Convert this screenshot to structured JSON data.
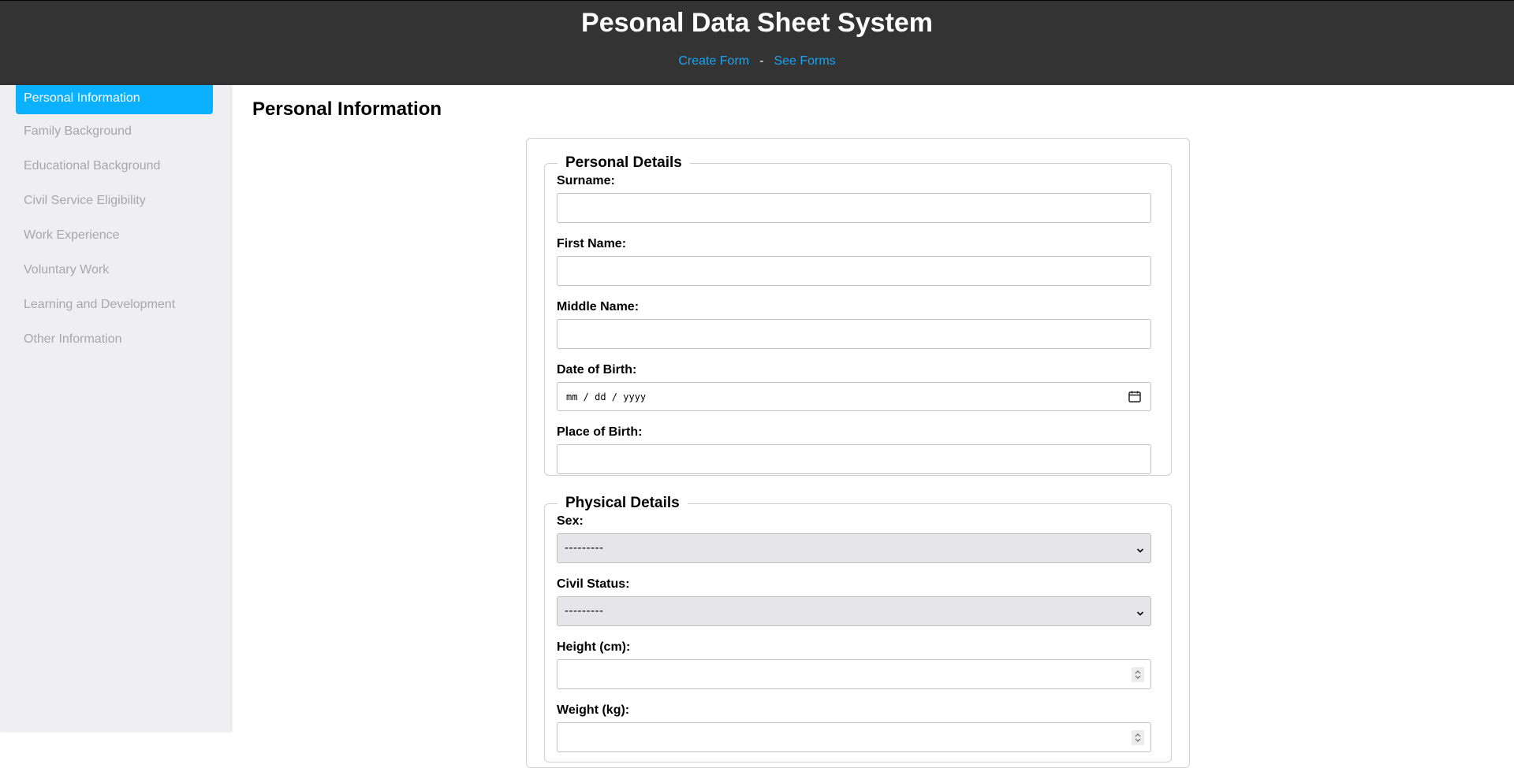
{
  "header": {
    "title": "Pesonal Data Sheet System",
    "nav": {
      "create_form": "Create Form",
      "separator": "-",
      "see_forms": "See Forms"
    }
  },
  "sidebar": {
    "items": [
      {
        "label": "Personal Information",
        "active": true
      },
      {
        "label": "Family Background"
      },
      {
        "label": "Educational Background"
      },
      {
        "label": "Civil Service Eligibility"
      },
      {
        "label": "Work Experience"
      },
      {
        "label": "Voluntary Work"
      },
      {
        "label": "Learning and Development"
      },
      {
        "label": "Other Information"
      }
    ]
  },
  "main": {
    "heading": "Personal Information",
    "personal_details": {
      "legend": "Personal Details",
      "surname_label": "Surname:",
      "surname_value": "",
      "first_name_label": "First Name:",
      "first_name_value": "",
      "middle_name_label": "Middle Name:",
      "middle_name_value": "",
      "dob_label": "Date of Birth:",
      "dob_placeholder": "mm / dd / yyyy",
      "pob_label": "Place of Birth:",
      "pob_value": ""
    },
    "physical_details": {
      "legend": "Physical Details",
      "sex_label": "Sex:",
      "sex_value": "---------",
      "civil_status_label": "Civil Status:",
      "civil_status_value": "---------",
      "height_label": "Height (cm):",
      "height_value": "",
      "weight_label": "Weight (kg):",
      "weight_value": ""
    }
  },
  "colors": {
    "header_bg": "#333333",
    "link": "#1ba3f2",
    "sidebar_active_bg": "#0bb0ff",
    "sidebar_bg": "#efeef0",
    "sidebar_inactive_text": "#a8a8a8"
  },
  "icons": [
    "calendar-icon",
    "chevron-down-icon",
    "spin-buttons-icon"
  ]
}
